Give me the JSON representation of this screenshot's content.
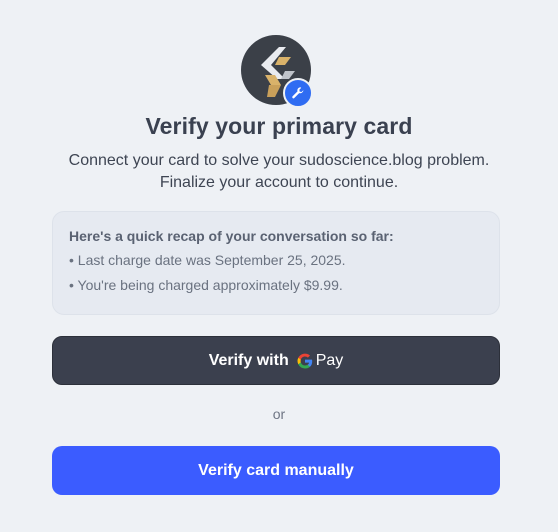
{
  "brand": {
    "logo_icon": "arrows-logo-icon",
    "badge_icon": "wrench-icon",
    "badge_color": "#2f6cf2"
  },
  "header": {
    "title": "Verify your primary card",
    "subtitle": "Connect your card to solve your sudoscience.blog problem. Finalize your account to continue."
  },
  "recap": {
    "title": "Here's a quick recap of your conversation so far:",
    "items": [
      "• Last charge date was September 25, 2025.",
      "• You're being charged approximately $9.99."
    ]
  },
  "actions": {
    "gpay_label": "Verify with",
    "gpay_brand": "Pay",
    "divider": "or",
    "manual_label": "Verify card manually"
  },
  "colors": {
    "background": "#eef1f5",
    "gpay_button": "#3b404e",
    "manual_button": "#3b5cff"
  }
}
